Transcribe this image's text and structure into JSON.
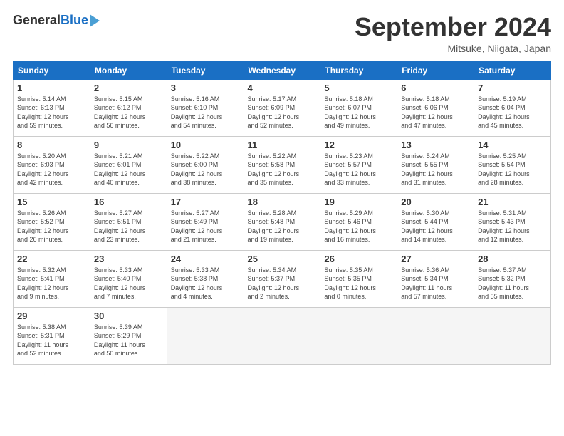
{
  "header": {
    "logo_general": "General",
    "logo_blue": "Blue",
    "month_title": "September 2024",
    "location": "Mitsuke, Niigata, Japan"
  },
  "days_of_week": [
    "Sunday",
    "Monday",
    "Tuesday",
    "Wednesday",
    "Thursday",
    "Friday",
    "Saturday"
  ],
  "weeks": [
    [
      {
        "day": "1",
        "info": "Sunrise: 5:14 AM\nSunset: 6:13 PM\nDaylight: 12 hours\nand 59 minutes."
      },
      {
        "day": "2",
        "info": "Sunrise: 5:15 AM\nSunset: 6:12 PM\nDaylight: 12 hours\nand 56 minutes."
      },
      {
        "day": "3",
        "info": "Sunrise: 5:16 AM\nSunset: 6:10 PM\nDaylight: 12 hours\nand 54 minutes."
      },
      {
        "day": "4",
        "info": "Sunrise: 5:17 AM\nSunset: 6:09 PM\nDaylight: 12 hours\nand 52 minutes."
      },
      {
        "day": "5",
        "info": "Sunrise: 5:18 AM\nSunset: 6:07 PM\nDaylight: 12 hours\nand 49 minutes."
      },
      {
        "day": "6",
        "info": "Sunrise: 5:18 AM\nSunset: 6:06 PM\nDaylight: 12 hours\nand 47 minutes."
      },
      {
        "day": "7",
        "info": "Sunrise: 5:19 AM\nSunset: 6:04 PM\nDaylight: 12 hours\nand 45 minutes."
      }
    ],
    [
      {
        "day": "8",
        "info": "Sunrise: 5:20 AM\nSunset: 6:03 PM\nDaylight: 12 hours\nand 42 minutes."
      },
      {
        "day": "9",
        "info": "Sunrise: 5:21 AM\nSunset: 6:01 PM\nDaylight: 12 hours\nand 40 minutes."
      },
      {
        "day": "10",
        "info": "Sunrise: 5:22 AM\nSunset: 6:00 PM\nDaylight: 12 hours\nand 38 minutes."
      },
      {
        "day": "11",
        "info": "Sunrise: 5:22 AM\nSunset: 5:58 PM\nDaylight: 12 hours\nand 35 minutes."
      },
      {
        "day": "12",
        "info": "Sunrise: 5:23 AM\nSunset: 5:57 PM\nDaylight: 12 hours\nand 33 minutes."
      },
      {
        "day": "13",
        "info": "Sunrise: 5:24 AM\nSunset: 5:55 PM\nDaylight: 12 hours\nand 31 minutes."
      },
      {
        "day": "14",
        "info": "Sunrise: 5:25 AM\nSunset: 5:54 PM\nDaylight: 12 hours\nand 28 minutes."
      }
    ],
    [
      {
        "day": "15",
        "info": "Sunrise: 5:26 AM\nSunset: 5:52 PM\nDaylight: 12 hours\nand 26 minutes."
      },
      {
        "day": "16",
        "info": "Sunrise: 5:27 AM\nSunset: 5:51 PM\nDaylight: 12 hours\nand 23 minutes."
      },
      {
        "day": "17",
        "info": "Sunrise: 5:27 AM\nSunset: 5:49 PM\nDaylight: 12 hours\nand 21 minutes."
      },
      {
        "day": "18",
        "info": "Sunrise: 5:28 AM\nSunset: 5:48 PM\nDaylight: 12 hours\nand 19 minutes."
      },
      {
        "day": "19",
        "info": "Sunrise: 5:29 AM\nSunset: 5:46 PM\nDaylight: 12 hours\nand 16 minutes."
      },
      {
        "day": "20",
        "info": "Sunrise: 5:30 AM\nSunset: 5:44 PM\nDaylight: 12 hours\nand 14 minutes."
      },
      {
        "day": "21",
        "info": "Sunrise: 5:31 AM\nSunset: 5:43 PM\nDaylight: 12 hours\nand 12 minutes."
      }
    ],
    [
      {
        "day": "22",
        "info": "Sunrise: 5:32 AM\nSunset: 5:41 PM\nDaylight: 12 hours\nand 9 minutes."
      },
      {
        "day": "23",
        "info": "Sunrise: 5:33 AM\nSunset: 5:40 PM\nDaylight: 12 hours\nand 7 minutes."
      },
      {
        "day": "24",
        "info": "Sunrise: 5:33 AM\nSunset: 5:38 PM\nDaylight: 12 hours\nand 4 minutes."
      },
      {
        "day": "25",
        "info": "Sunrise: 5:34 AM\nSunset: 5:37 PM\nDaylight: 12 hours\nand 2 minutes."
      },
      {
        "day": "26",
        "info": "Sunrise: 5:35 AM\nSunset: 5:35 PM\nDaylight: 12 hours\nand 0 minutes."
      },
      {
        "day": "27",
        "info": "Sunrise: 5:36 AM\nSunset: 5:34 PM\nDaylight: 11 hours\nand 57 minutes."
      },
      {
        "day": "28",
        "info": "Sunrise: 5:37 AM\nSunset: 5:32 PM\nDaylight: 11 hours\nand 55 minutes."
      }
    ],
    [
      {
        "day": "29",
        "info": "Sunrise: 5:38 AM\nSunset: 5:31 PM\nDaylight: 11 hours\nand 52 minutes."
      },
      {
        "day": "30",
        "info": "Sunrise: 5:39 AM\nSunset: 5:29 PM\nDaylight: 11 hours\nand 50 minutes."
      },
      {
        "day": "",
        "info": ""
      },
      {
        "day": "",
        "info": ""
      },
      {
        "day": "",
        "info": ""
      },
      {
        "day": "",
        "info": ""
      },
      {
        "day": "",
        "info": ""
      }
    ]
  ]
}
